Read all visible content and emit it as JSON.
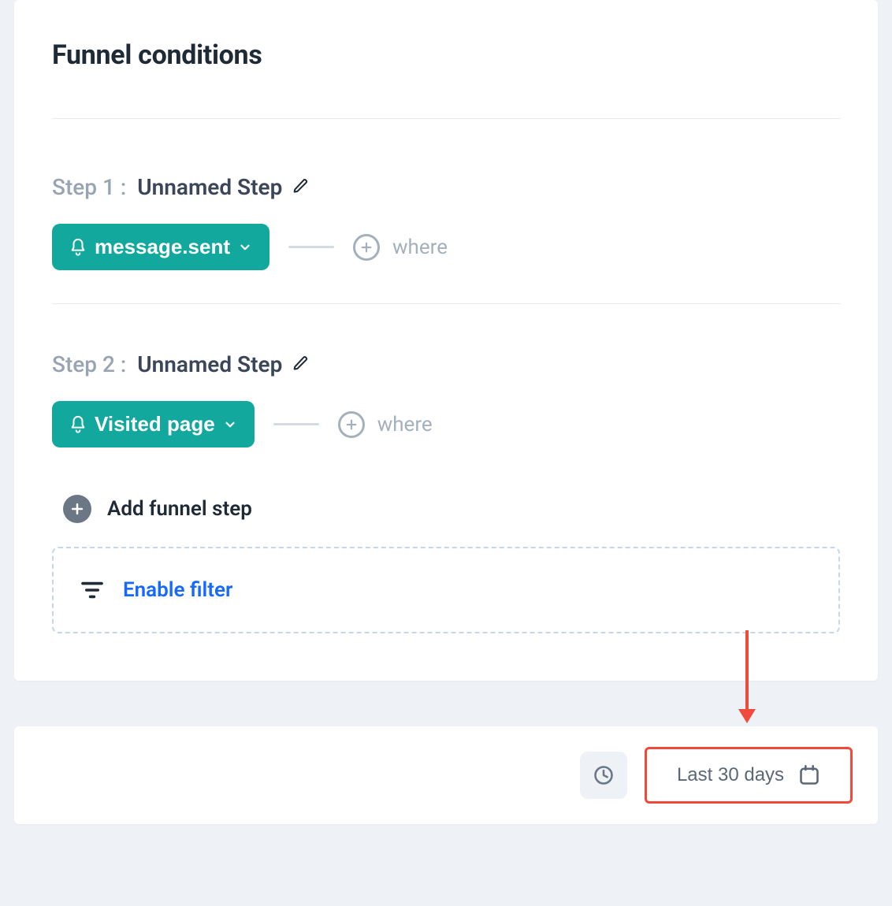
{
  "header": {
    "title": "Funnel conditions"
  },
  "steps": [
    {
      "index_label": "Step 1 :",
      "name": "Unnamed Step",
      "event": "message.sent",
      "where_label": "where"
    },
    {
      "index_label": "Step 2 :",
      "name": "Unnamed Step",
      "event": "Visited page",
      "where_label": "where"
    }
  ],
  "add_step": {
    "label": "Add funnel step"
  },
  "filter": {
    "label": "Enable filter"
  },
  "toolbar": {
    "range_label": "Last 30 days"
  },
  "colors": {
    "accent_teal": "#12a89d",
    "link_blue": "#1569ff",
    "highlight_red": "#ef4a3c"
  }
}
